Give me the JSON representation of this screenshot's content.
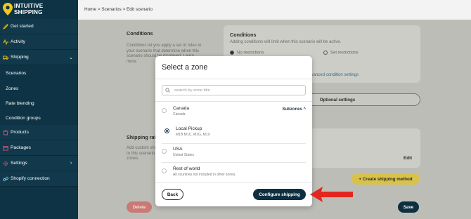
{
  "brand": {
    "line1": "INTUITIVE",
    "line2": "SHIPPING",
    "logo_icon": "location-pin-icon",
    "accent": "#f5c518"
  },
  "sidebar": {
    "items": [
      {
        "label": "Get started",
        "icon": "rocket-icon"
      },
      {
        "label": "Activity",
        "icon": "activity-icon"
      },
      {
        "label": "Shipping",
        "icon": "truck-icon",
        "chevron": "⌄"
      },
      {
        "label": "Scenarios"
      },
      {
        "label": "Zones"
      },
      {
        "label": "Rate blending"
      },
      {
        "label": "Condition groups"
      },
      {
        "label": "Products",
        "icon": "product-icon"
      },
      {
        "label": "Packages",
        "icon": "package-icon"
      },
      {
        "label": "Settings",
        "icon": "gear-icon",
        "chevron": "›"
      },
      {
        "label": "Shopify connection",
        "icon": "link-icon"
      }
    ]
  },
  "breadcrumb": "Home > Scenarios > Edit scenario",
  "background": {
    "conditions_heading": "Conditions",
    "conditions_desc": "Conditions let you apply a set of rules to your scenario that determine when this scenario should be displayed. Learn more.",
    "conditions_card_title": "Conditions",
    "conditions_card_desc": "Adding conditions will limit when this scenario will be active.",
    "no_restrictions": "No restrictions",
    "set_restrictions": "Set restrictions",
    "advanced_link": "Advanced condition settings",
    "optional_settings": "Optional settings",
    "shipping_rates_heading": "Shipping rates",
    "shipping_rates_desc": "Add custom shipping methods and rates to this scenario and add services to your zones.",
    "edit": "Edit",
    "create_shipping_method": "+ Create shipping method",
    "delete": "Delete",
    "save": "Save"
  },
  "modal": {
    "title": "Select a zone",
    "search_placeholder": "search by zone title",
    "search_value": "",
    "zones": [
      {
        "name": "Canada",
        "detail": "Canada",
        "selected": false,
        "subzones_label": "Subzones ^"
      },
      {
        "name": "Local Pickup",
        "detail": "M1B M1C, M1G, M1X",
        "selected": true
      },
      {
        "name": "USA",
        "detail": "United States",
        "selected": false
      },
      {
        "name": "Rest of world",
        "detail": "All countries not included in other zones.",
        "selected": false
      }
    ],
    "back_label": "Back",
    "configure_label": "Configure shipping"
  },
  "colors": {
    "sidebar_bg": "#0d3344",
    "primary_button": "#0d2f3f",
    "annotation_arrow": "#e3261f",
    "delete_button": "#c97a75",
    "create_button": "#d8c24a"
  }
}
